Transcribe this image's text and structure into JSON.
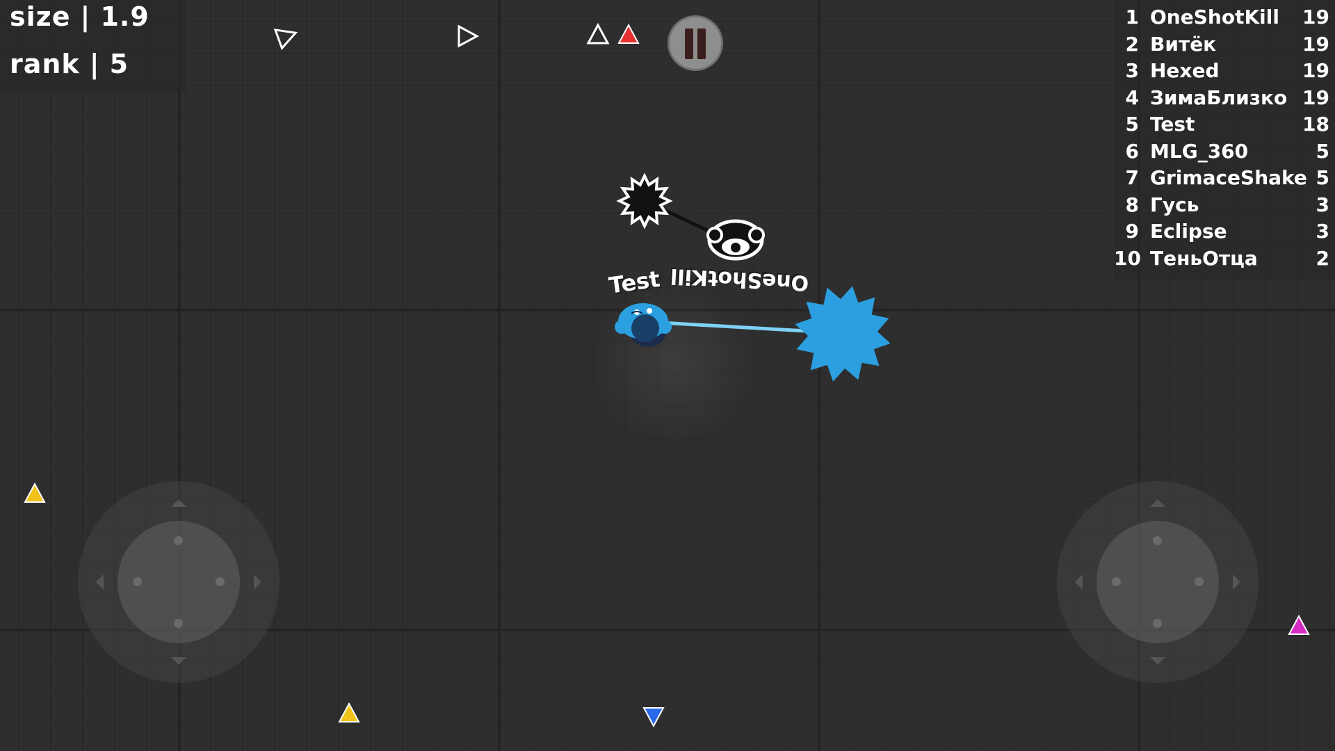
{
  "hud": {
    "size_label": "size",
    "size_value": "1.9",
    "rank_label": "rank",
    "rank_value": "5",
    "separator": "|"
  },
  "leaderboard": [
    {
      "rank": "1",
      "name": "OneShotKill",
      "score": "19"
    },
    {
      "rank": "2",
      "name": "Витёк",
      "score": "19"
    },
    {
      "rank": "3",
      "name": "Hexed",
      "score": "19"
    },
    {
      "rank": "4",
      "name": "ЗимаБлизко",
      "score": "19"
    },
    {
      "rank": "5",
      "name": "Test",
      "score": "18"
    },
    {
      "rank": "6",
      "name": "MLG_360",
      "score": "5"
    },
    {
      "rank": "7",
      "name": "GrimaceShake",
      "score": "5"
    },
    {
      "rank": "8",
      "name": "Гусь",
      "score": "3"
    },
    {
      "rank": "9",
      "name": "Eclipse",
      "score": "3"
    },
    {
      "rank": "10",
      "name": "ТеньОтца",
      "score": "2"
    }
  ],
  "players": {
    "self_name": "Test",
    "enemy_name": "OneShotKill"
  },
  "colors": {
    "self": "#2b9fe0",
    "enemy": "#111111",
    "outline": "#ffffff"
  },
  "pickups": [
    {
      "color": "#ffffff"
    },
    {
      "color": "#ffffff"
    },
    {
      "color": "#ffffff"
    },
    {
      "color": "#e63232"
    },
    {
      "color": "#f2c21a"
    },
    {
      "color": "#f2c21a"
    },
    {
      "color": "#2a68e8"
    },
    {
      "color": "#d62bc4"
    }
  ],
  "icons": {
    "pause": "pause-icon",
    "left_joystick": "move-joystick-icon",
    "right_joystick": "aim-joystick-icon"
  }
}
